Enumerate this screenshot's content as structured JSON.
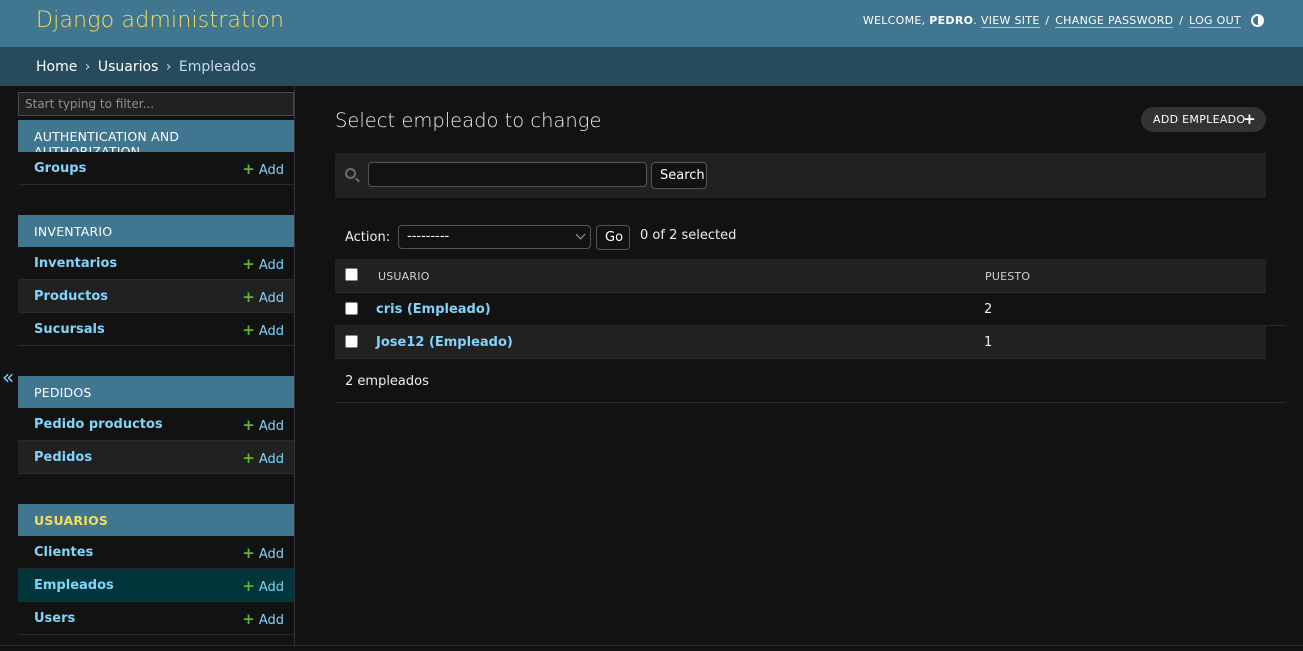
{
  "header": {
    "site_name": "Django administration",
    "welcome": "WELCOME,",
    "username": "PEDRO",
    "view_site": "VIEW SITE",
    "change_password": "CHANGE PASSWORD",
    "log_out": "LOG OUT",
    "separator": "/",
    "theme_icon": "contrast-icon"
  },
  "breadcrumbs": {
    "home": "Home",
    "app": "Usuarios",
    "current": "Empleados",
    "separator": "›"
  },
  "sidebar": {
    "filter_placeholder": "Start typing to filter...",
    "toggle": "«",
    "add_label": "Add",
    "add_icon": "+",
    "modules": [
      {
        "caption": "AUTHENTICATION AND AUTHORIZATION",
        "models": [
          "Groups"
        ]
      },
      {
        "caption": "INVENTARIO",
        "models": [
          "Inventarios",
          "Productos",
          "Sucursals"
        ]
      },
      {
        "caption": "PEDIDOS",
        "models": [
          "Pedido productos",
          "Pedidos"
        ]
      },
      {
        "caption": "USUARIOS",
        "models": [
          "Clientes",
          "Empleados",
          "Users"
        ]
      }
    ]
  },
  "content": {
    "title": "Select empleado to change",
    "add_button": "ADD EMPLEADO",
    "add_button_icon": "+",
    "search_button": "Search",
    "search_value": "",
    "action_label": "Action:",
    "action_selected": "---------",
    "go_button": "Go",
    "selection_counter": "0 of 2 selected",
    "columns": [
      "USUARIO",
      "PUESTO"
    ],
    "rows": [
      {
        "usuario": "cris (Empleado)",
        "puesto": "2"
      },
      {
        "usuario": "Jose12 (Empleado)",
        "puesto": "1"
      }
    ],
    "result_count": "2 empleados"
  },
  "colors": {
    "header_bg": "#417690",
    "breadcrumbs_bg": "#264b5d",
    "branding": "#f5dd5d",
    "link": "#81d4fa",
    "add_green": "#5fb336",
    "selected_row": "#00363a",
    "background": "#121212"
  }
}
